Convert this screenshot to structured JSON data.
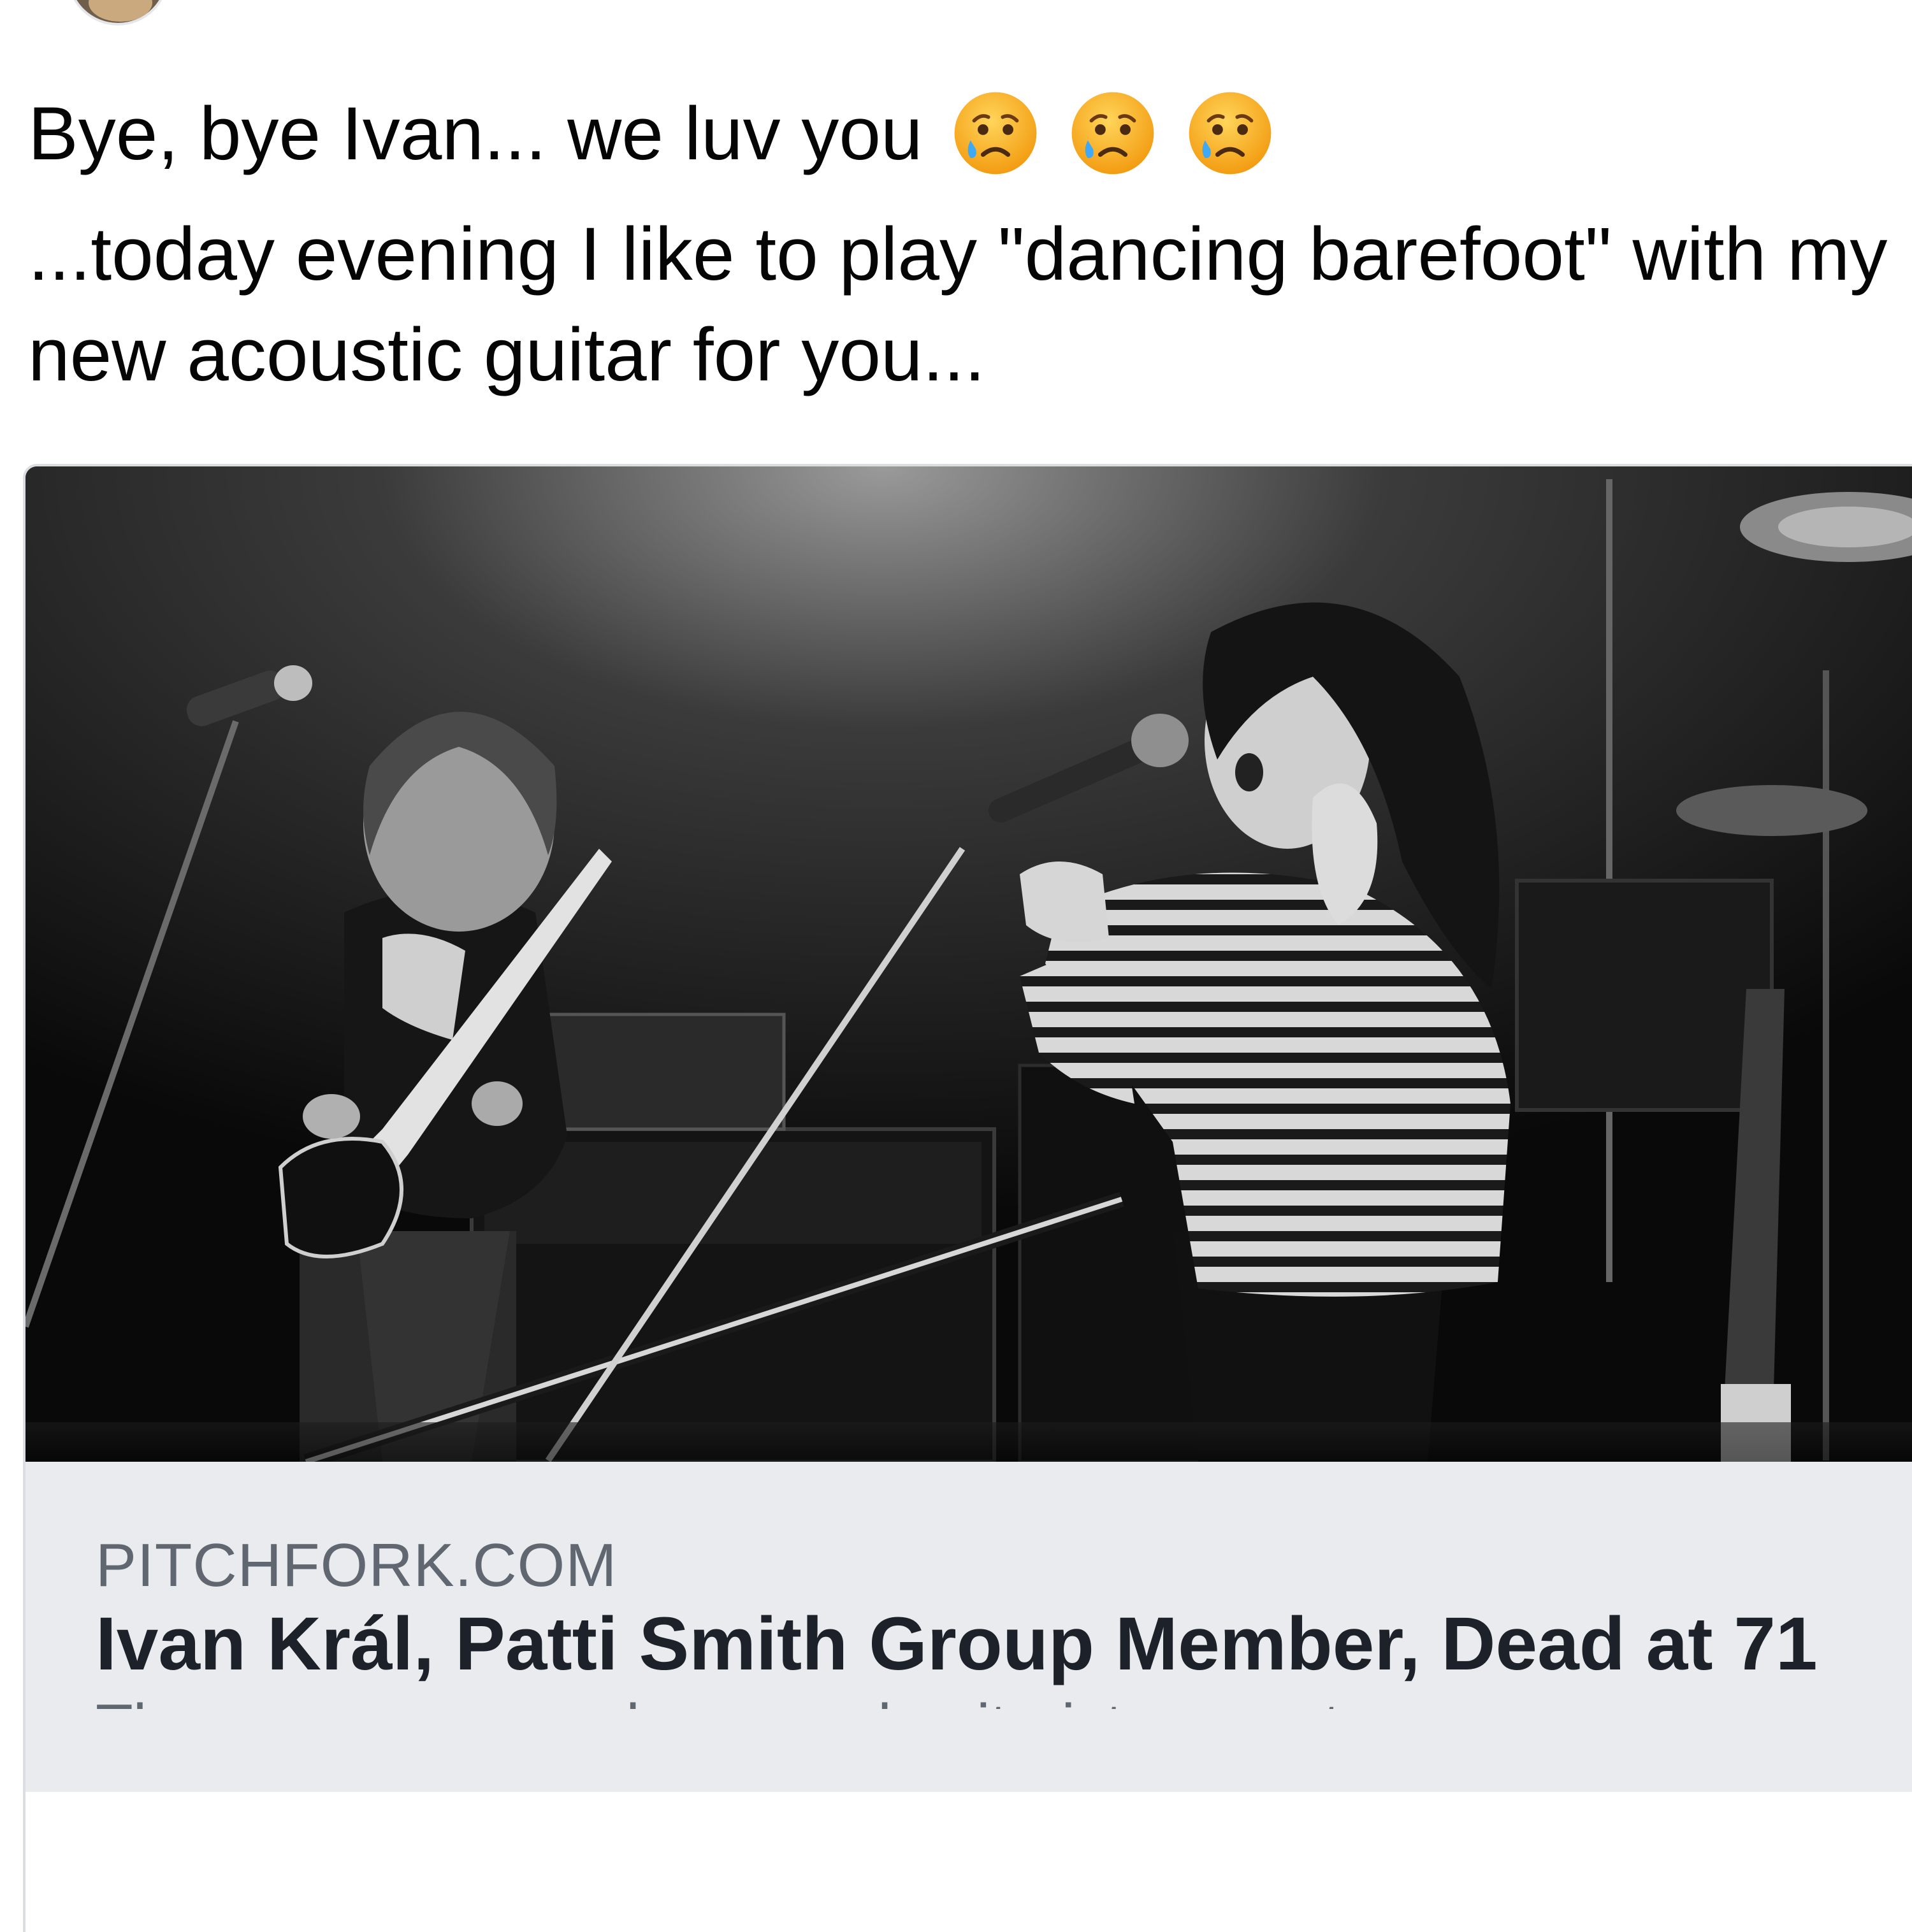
{
  "post": {
    "line1": "Bye, bye Ivan... we luv you",
    "emojis": [
      "crying-face-icon",
      "crying-face-icon",
      "crying-face-icon"
    ],
    "body": "...today evening I like to play \"dancing barefoot\" with my new acoustic guitar for you..."
  },
  "link_card": {
    "domain": "PITCHFORK.COM",
    "headline": "Ivan Král, Patti Smith Group Member, Dead at 71",
    "description": "The composer, producer, and guitarist co-wrote many son..."
  },
  "colors": {
    "meta_background": "#e9ebee",
    "domain_text": "#606770",
    "headline_text": "#1d2129",
    "emoji_face": "#f7b52a"
  }
}
